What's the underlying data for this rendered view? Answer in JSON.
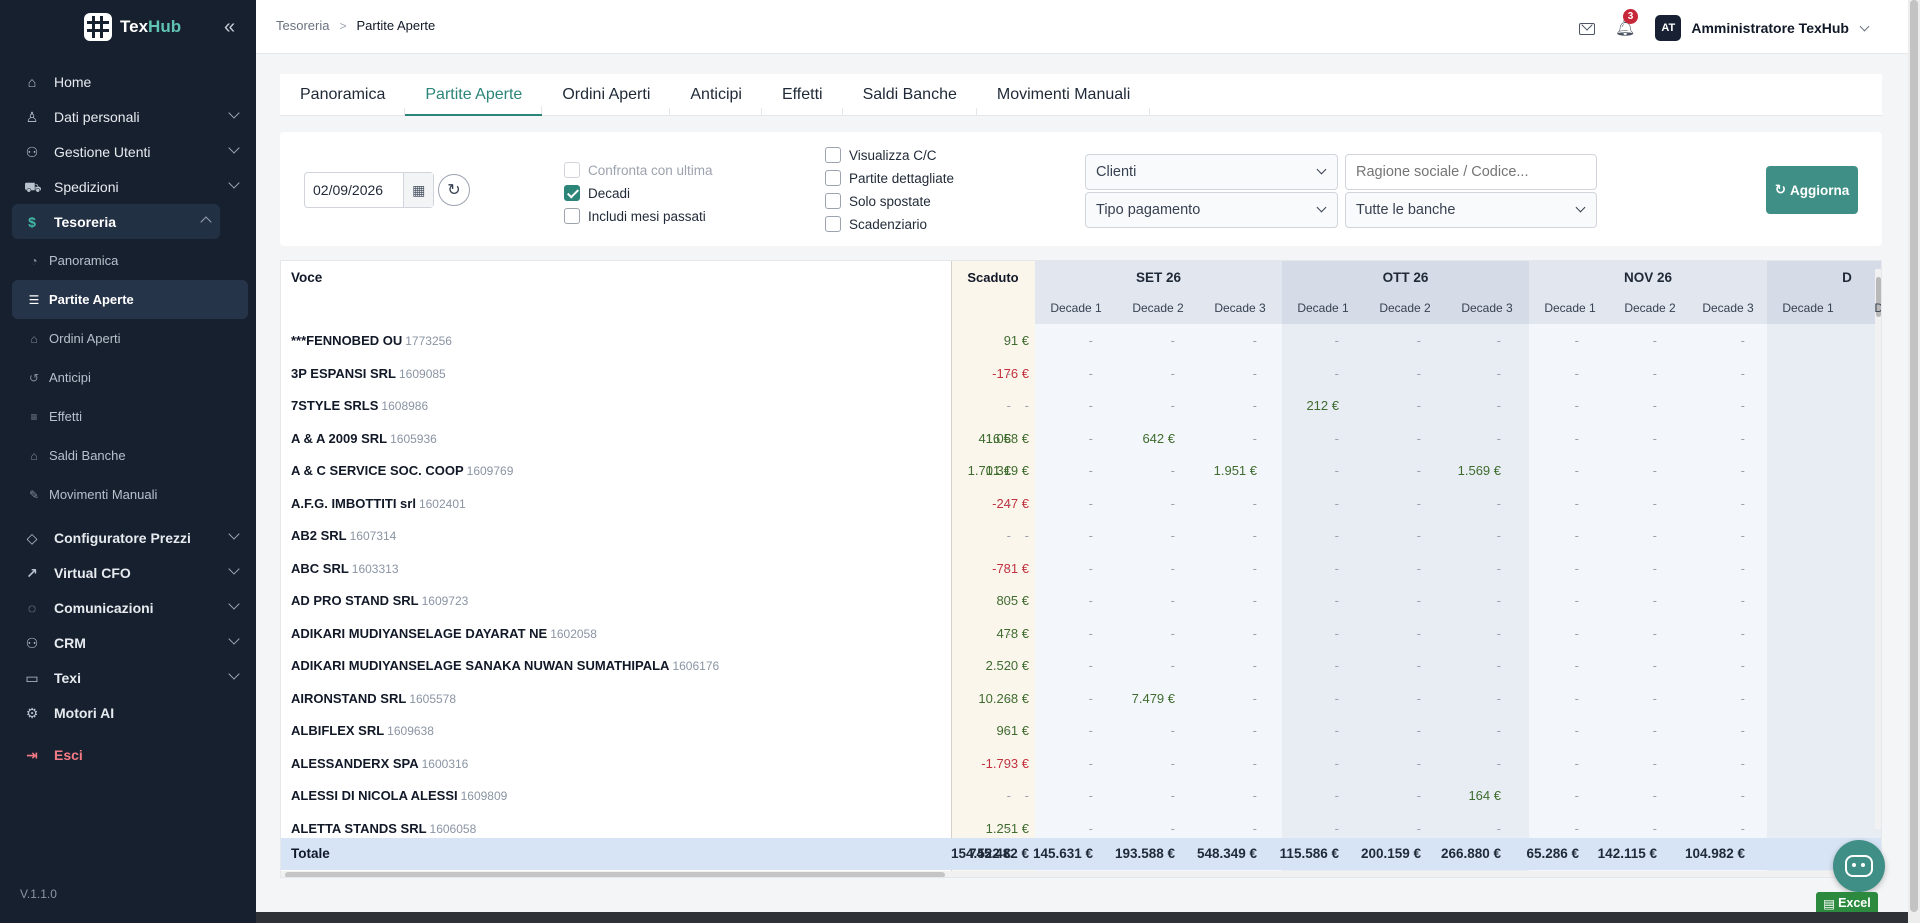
{
  "app": {
    "name_main": "Tex",
    "name_accent": "Hub",
    "version": "V.1.1.0"
  },
  "sidebar": {
    "items": [
      {
        "label": "Home",
        "icon": "home-icon",
        "glyph": "⌂",
        "chev": false
      },
      {
        "label": "Dati personali",
        "icon": "user-icon",
        "glyph": "♙",
        "chev": true
      },
      {
        "label": "Gestione Utenti",
        "icon": "users-icon",
        "glyph": "⚇",
        "chev": true
      },
      {
        "label": "Spedizioni",
        "icon": "truck-icon",
        "glyph": "⛟",
        "chev": true
      }
    ],
    "active_parent": {
      "label": "Tesoreria",
      "icon": "coin-icon",
      "glyph": "$"
    },
    "sub_items": [
      {
        "label": "Panoramica",
        "glyph": "◔",
        "icon": "chart-pie-icon",
        "active": false
      },
      {
        "label": "Partite Aperte",
        "glyph": "☰",
        "icon": "list-icon",
        "active": true
      },
      {
        "label": "Ordini Aperti",
        "glyph": "⌂",
        "icon": "basket-icon",
        "active": false
      },
      {
        "label": "Anticipi",
        "glyph": "↺",
        "icon": "refresh-icon",
        "active": false
      },
      {
        "label": "Effetti",
        "glyph": "≡",
        "icon": "document-icon",
        "active": false
      },
      {
        "label": "Saldi Banche",
        "glyph": "⌂",
        "icon": "bank-icon",
        "active": false
      },
      {
        "label": "Movimenti Manuali",
        "glyph": "✎",
        "icon": "edit-icon",
        "active": false
      }
    ],
    "items_after": [
      {
        "label": "Configuratore Prezzi",
        "icon": "tag-icon",
        "glyph": "◇",
        "chev": true
      },
      {
        "label": "Virtual CFO",
        "icon": "trend-icon",
        "glyph": "↗",
        "chev": true
      },
      {
        "label": "Comunicazioni",
        "icon": "message-icon",
        "glyph": "◌",
        "chev": true
      },
      {
        "label": "CRM",
        "icon": "contacts-icon",
        "glyph": "⚇",
        "chev": true
      },
      {
        "label": "Texi",
        "icon": "folder-icon",
        "glyph": "▭",
        "chev": true
      },
      {
        "label": "Motori AI",
        "icon": "cpu-icon",
        "glyph": "⚙",
        "chev": false
      }
    ],
    "logout": {
      "label": "Esci",
      "glyph": "⇥"
    }
  },
  "header": {
    "breadcrumb_parent": "Tesoreria",
    "breadcrumb_sep": ">",
    "breadcrumb_current": "Partite Aperte",
    "notifications": "3",
    "user_initials": "AT",
    "user_name": "Amministratore TexHub"
  },
  "tabs": [
    {
      "label": "Panoramica",
      "active": false
    },
    {
      "label": "Partite Aperte",
      "active": true
    },
    {
      "label": "Ordini Aperti",
      "active": false
    },
    {
      "label": "Anticipi",
      "active": false
    },
    {
      "label": "Effetti",
      "active": false
    },
    {
      "label": "Saldi Banche",
      "active": false
    },
    {
      "label": "Movimenti Manuali",
      "active": false
    }
  ],
  "filters": {
    "date": "02/09/2026",
    "checks_a": [
      {
        "label": "Confronta con ultima",
        "checked": false,
        "disabled": true
      },
      {
        "label": "Decadi",
        "checked": true,
        "disabled": false
      },
      {
        "label": "Includi mesi passati",
        "checked": false,
        "disabled": false
      }
    ],
    "checks_b": [
      {
        "label": "Visualizza C/C",
        "checked": false
      },
      {
        "label": "Partite dettagliate",
        "checked": false
      },
      {
        "label": "Solo spostate",
        "checked": false
      },
      {
        "label": "Scadenziario",
        "checked": false
      }
    ],
    "clients_select": "Clienti",
    "payment_select": "Tipo pagamento",
    "bank_select": "Tutte le banche",
    "search_placeholder": "Ragione sociale / Codice...",
    "refresh_label": "Aggiorna"
  },
  "table": {
    "voce_header": "Voce",
    "scaduto_header": "Scaduto",
    "months": [
      "SET 26",
      "OTT 26",
      "NOV 26",
      "D"
    ],
    "decade_label": "Decade 1",
    "decade_labels": [
      "Decade 1",
      "Decade 2",
      "Decade 3",
      "Decade 1",
      "Decade 2",
      "Decade 3",
      "Decade 1",
      "Decade 2",
      "Decade 3",
      "Decade 1",
      "De"
    ],
    "rows": [
      {
        "name": "***FENNOBED OU",
        "code": "1773256",
        "scaduto": "91 €",
        "vals": [
          "-",
          "-",
          "-",
          "-",
          "-",
          "-",
          "-",
          "-",
          "-",
          "-"
        ]
      },
      {
        "name": "3P ESPANSI SRL",
        "code": "1609085",
        "scaduto": "-176 €",
        "vals": [
          "-",
          "-",
          "-",
          "-",
          "-",
          "-",
          "-",
          "-",
          "-",
          "-"
        ]
      },
      {
        "name": "7STYLE SRLS",
        "code": "1608986",
        "scaduto": "-",
        "vals": [
          "-",
          "-",
          "-",
          "-",
          "212 €",
          "-",
          "-",
          "-",
          "-",
          "-"
        ]
      },
      {
        "name": "A & A 2009 SRL",
        "code": "1605936",
        "scaduto": "1.058 €",
        "vals": [
          "416 €",
          "-",
          "642 €",
          "-",
          "-",
          "-",
          "-",
          "-",
          "-",
          "-"
        ]
      },
      {
        "name": "A & C SERVICE SOC. COOP",
        "code": "1609769",
        "scaduto": "1.319 €",
        "vals": [
          "1.701 €",
          "-",
          "-",
          "1.951 €",
          "-",
          "-",
          "1.569 €",
          "-",
          "-",
          "-"
        ]
      },
      {
        "name": "A.F.G. IMBOTTITI srl",
        "code": "1602401",
        "scaduto": "-247 €",
        "vals": [
          "-",
          "-",
          "-",
          "-",
          "-",
          "-",
          "-",
          "-",
          "-",
          "-"
        ]
      },
      {
        "name": "AB2 SRL",
        "code": "1607314",
        "scaduto": "-",
        "vals": [
          "-",
          "-",
          "-",
          "-",
          "-",
          "-",
          "-",
          "-",
          "-",
          "-"
        ]
      },
      {
        "name": "ABC SRL",
        "code": "1603313",
        "scaduto": "-781 €",
        "vals": [
          "-",
          "-",
          "-",
          "-",
          "-",
          "-",
          "-",
          "-",
          "-",
          "-"
        ]
      },
      {
        "name": "AD PRO STAND SRL",
        "code": "1609723",
        "scaduto": "805 €",
        "vals": [
          "-",
          "-",
          "-",
          "-",
          "-",
          "-",
          "-",
          "-",
          "-",
          "-"
        ]
      },
      {
        "name": "ADIKARI MUDIYANSELAGE DAYARAT NE",
        "code": "1602058",
        "scaduto": "478 €",
        "vals": [
          "-",
          "-",
          "-",
          "-",
          "-",
          "-",
          "-",
          "-",
          "-",
          "-"
        ]
      },
      {
        "name": "ADIKARI MUDIYANSELAGE SANAKA NUWAN SUMATHIPALA",
        "code": "1606176",
        "scaduto": "2.520 €",
        "vals": [
          "-",
          "-",
          "-",
          "-",
          "-",
          "-",
          "-",
          "-",
          "-",
          "-"
        ]
      },
      {
        "name": "AIRONSTAND SRL",
        "code": "1605578",
        "scaduto": "10.268 €",
        "vals": [
          "-",
          "-",
          "7.479 €",
          "-",
          "-",
          "-",
          "-",
          "-",
          "-",
          "-"
        ]
      },
      {
        "name": "ALBIFLEX SRL",
        "code": "1609638",
        "scaduto": "961 €",
        "vals": [
          "-",
          "-",
          "-",
          "-",
          "-",
          "-",
          "-",
          "-",
          "-",
          "-"
        ]
      },
      {
        "name": "ALESSANDERX SPA",
        "code": "1600316",
        "scaduto": "-1.793 €",
        "vals": [
          "-",
          "-",
          "-",
          "-",
          "-",
          "-",
          "-",
          "-",
          "-",
          "-"
        ]
      },
      {
        "name": "ALESSI DI NICOLA ALESSI",
        "code": "1609809",
        "scaduto": "-",
        "vals": [
          "-",
          "-",
          "-",
          "-",
          "-",
          "-",
          "164 €",
          "-",
          "-",
          "-"
        ]
      },
      {
        "name": "ALETTA STANDS SRL",
        "code": "1606058",
        "scaduto": "1.251 €",
        "vals": [
          "-",
          "-",
          "-",
          "-",
          "-",
          "-",
          "-",
          "-",
          "-",
          "-"
        ]
      }
    ],
    "totale_label": "Totale",
    "totale_scaduto": "745.482 €",
    "totale_vals": [
      "154.522 €",
      "145.631 €",
      "193.588 €",
      "548.349 €",
      "115.586 €",
      "200.159 €",
      "266.880 €",
      "65.286 €",
      "142.115 €",
      "104.982 €"
    ]
  },
  "excel_label": "Excel"
}
